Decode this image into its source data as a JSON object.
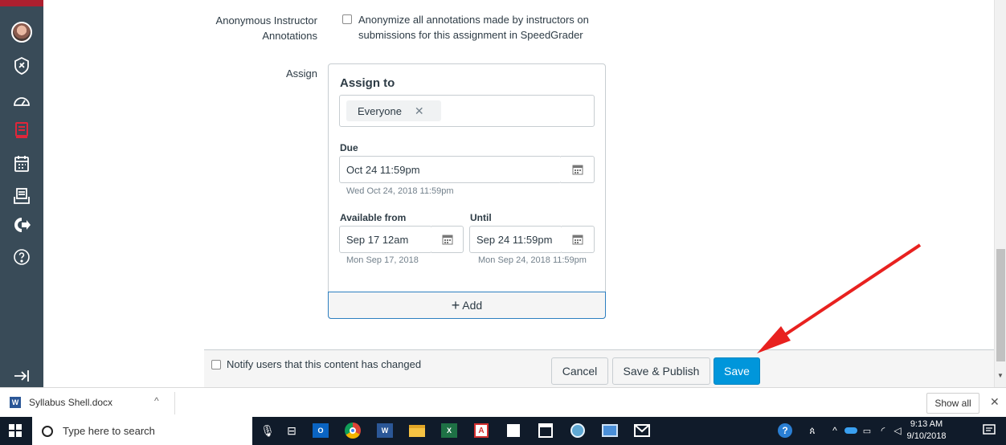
{
  "nav": {
    "items": [
      "avatar",
      "admin-icon",
      "dashboard-icon",
      "courses-icon",
      "calendar-icon",
      "inbox-icon",
      "commons-icon",
      "help-icon"
    ],
    "collapse_icon": "collapse-icon"
  },
  "settings": {
    "anon_label_1": "Anonymous Instructor",
    "anon_label_2": "Annotations",
    "anon_text_1": "Anonymize all annotations made by instructors on",
    "anon_text_2": "submissions for this assignment in SpeedGrader",
    "assign_label": "Assign"
  },
  "assign": {
    "assign_to_label": "Assign to",
    "assignee_tag": "Everyone",
    "due_label": "Due",
    "due_value": "Oct 24 11:59pm",
    "due_hint": "Wed Oct 24, 2018 11:59pm",
    "available_label": "Available from",
    "available_value": "Sep 17 12am",
    "available_hint": "Mon Sep 17, 2018",
    "until_label": "Until",
    "until_value": "Sep 24 11:59pm",
    "until_hint": "Mon Sep 24, 2018 11:59pm",
    "add_label": "Add"
  },
  "footer": {
    "notify_label": "Notify users that this content has changed",
    "cancel_label": "Cancel",
    "save_publish_label": "Save & Publish",
    "save_label": "Save"
  },
  "download_bar": {
    "file_name": "Syllabus Shell.docx",
    "show_all_label": "Show all"
  },
  "taskbar": {
    "search_placeholder": "Type here to search",
    "time": "9:13 AM",
    "date": "9/10/2018"
  },
  "colors": {
    "nav_bg": "#394b58",
    "nav_accent": "#ad1f2f",
    "primary": "#0096db",
    "annotation_arrow": "#e8211f",
    "taskbar_bg": "#101b2a"
  }
}
